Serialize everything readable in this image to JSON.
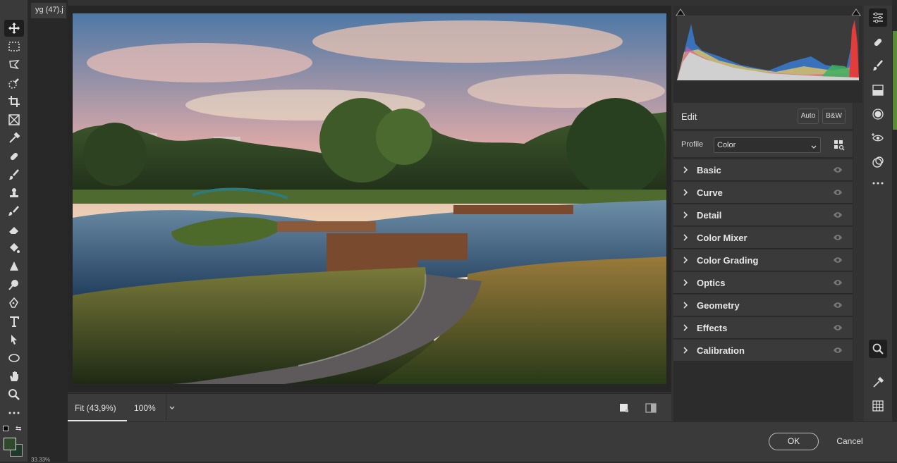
{
  "document": {
    "tab_title": "yg (47).j",
    "zoom_readout": "33.33%"
  },
  "toolbar": {
    "tools": [
      "move-tool-icon",
      "marquee-tool-icon",
      "lasso-tool-icon",
      "quick-select-tool-icon",
      "crop-tool-icon",
      "frame-tool-icon",
      "eyedropper-tool-icon",
      "healing-brush-icon",
      "brush-tool-icon",
      "clone-stamp-icon",
      "history-brush-icon",
      "eraser-tool-icon",
      "paint-bucket-icon",
      "blur-tool-icon",
      "dodge-tool-icon",
      "pen-tool-icon",
      "type-tool-icon",
      "path-select-icon",
      "ellipse-tool-icon",
      "hand-tool-icon",
      "zoom-tool-icon",
      "more-tools-icon"
    ],
    "foreground_color": "#2f4a2a",
    "background_color": "#1f3a2a"
  },
  "preview": {
    "fit_label": "Fit (43,9%)",
    "zoom_label": "100%"
  },
  "edit": {
    "title": "Edit",
    "auto_label": "Auto",
    "bw_label": "B&W",
    "profile_label": "Profile",
    "profile_value": "Color"
  },
  "sections": [
    {
      "label": "Basic"
    },
    {
      "label": "Curve"
    },
    {
      "label": "Detail"
    },
    {
      "label": "Color Mixer"
    },
    {
      "label": "Color Grading"
    },
    {
      "label": "Optics"
    },
    {
      "label": "Geometry"
    },
    {
      "label": "Effects"
    },
    {
      "label": "Calibration"
    }
  ],
  "rail": [
    "edit-sliders-icon",
    "healing-icon",
    "masking-brush-icon",
    "linear-gradient-icon",
    "radial-gradient-icon",
    "red-eye-icon",
    "presets-icon",
    "more-icon",
    "zoom-icon",
    "color-sampler-icon",
    "grid-overlay-icon"
  ],
  "footer": {
    "ok_label": "OK",
    "cancel_label": "Cancel"
  },
  "colors": {
    "accent_ok_border": "#bdbdbd",
    "panel": "#3a3a3a"
  }
}
